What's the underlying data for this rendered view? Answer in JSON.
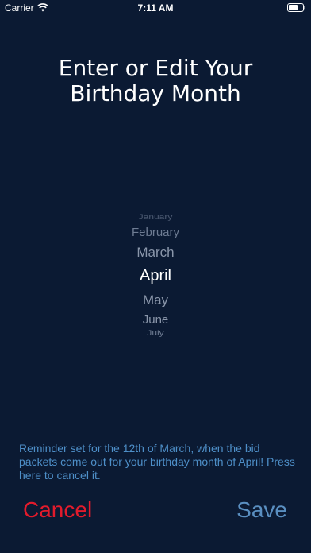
{
  "status_bar": {
    "carrier": "Carrier",
    "time": "7:11 AM",
    "wifi_icon": "wifi-icon",
    "battery_icon": "battery-icon"
  },
  "title": {
    "line1": "Enter or Edit Your",
    "line2": "Birthday Month"
  },
  "picker": {
    "selected": "April",
    "options": [
      "January",
      "February",
      "March",
      "April",
      "May",
      "June",
      "July"
    ]
  },
  "reminder": "Reminder set for the 12th of March, when the bid packets come out for your birthday month of April! Press here to cancel it.",
  "actions": {
    "cancel_label": "Cancel",
    "save_label": "Save"
  },
  "colors": {
    "background": "#0b1a33",
    "cancel": "#e31b2c",
    "save": "#5a8fc1",
    "reminder": "#4e8fc8"
  }
}
